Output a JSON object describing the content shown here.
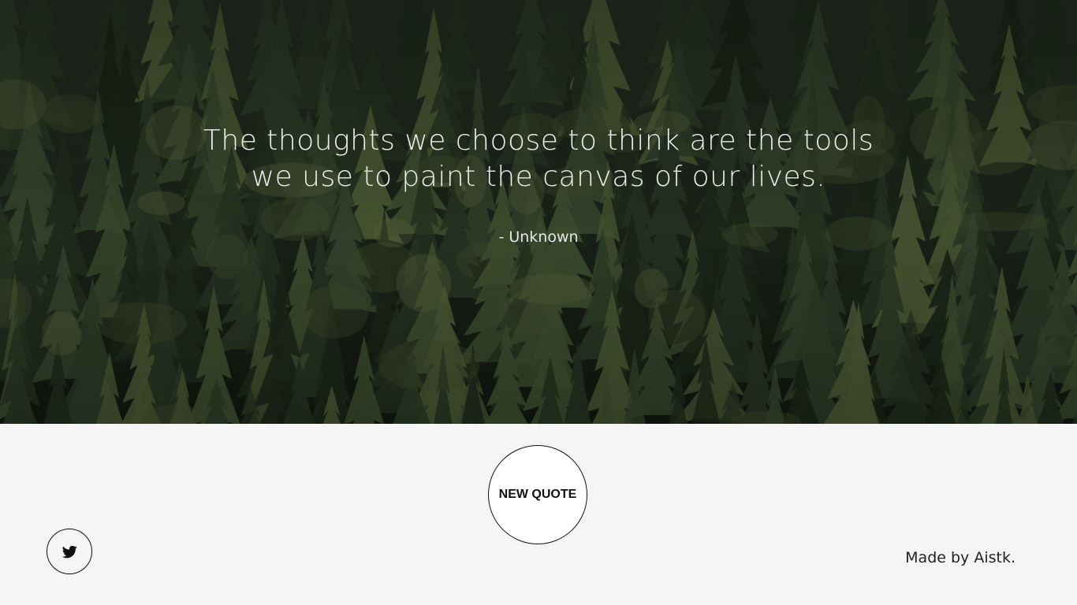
{
  "quote": {
    "text": "The thoughts we choose to think are the tools we use to paint the canvas of our lives.",
    "author": "- Unknown"
  },
  "actions": {
    "new_quote_label": "NEW QUOTE",
    "tweet_icon": "twitter-icon"
  },
  "footer": {
    "credit": "Made by Aistk."
  },
  "colors": {
    "hero_overlay": "#1c2419",
    "quote_text": "#ececec",
    "bottom_background": "#f5f5f5",
    "button_border": "#111111"
  }
}
